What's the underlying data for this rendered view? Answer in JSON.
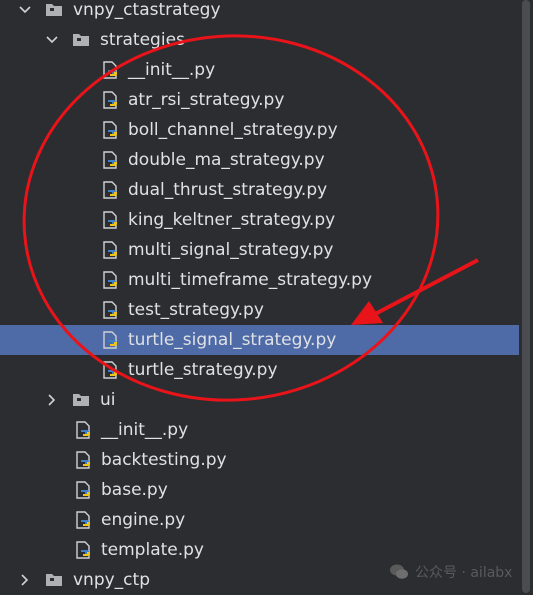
{
  "tree": {
    "root": {
      "label": "vnpy_ctastrategy"
    },
    "strategies_folder": {
      "label": "strategies"
    },
    "strategy_files": [
      {
        "label": "__init__.py"
      },
      {
        "label": "atr_rsi_strategy.py"
      },
      {
        "label": "boll_channel_strategy.py"
      },
      {
        "label": "double_ma_strategy.py"
      },
      {
        "label": "dual_thrust_strategy.py"
      },
      {
        "label": "king_keltner_strategy.py"
      },
      {
        "label": "multi_signal_strategy.py"
      },
      {
        "label": "multi_timeframe_strategy.py"
      },
      {
        "label": "test_strategy.py"
      },
      {
        "label": "turtle_signal_strategy.py",
        "selected": true
      },
      {
        "label": "turtle_strategy.py"
      }
    ],
    "ui_folder": {
      "label": "ui"
    },
    "root_files": [
      {
        "label": "__init__.py"
      },
      {
        "label": "backtesting.py"
      },
      {
        "label": "base.py"
      },
      {
        "label": "engine.py"
      },
      {
        "label": "template.py"
      }
    ],
    "next_root": {
      "label": "vnpy_ctp"
    }
  },
  "watermark": {
    "text": "公众号 · ailabx"
  },
  "colors": {
    "background": "#2b2d30",
    "selection": "#4e6ba8",
    "annotation": "#e8141a",
    "text": "#dfe1e5"
  },
  "icons": {
    "folder": "folder-icon",
    "python_file": "python-file-icon",
    "expand": "chevron-down-icon",
    "collapse": "chevron-right-icon"
  }
}
